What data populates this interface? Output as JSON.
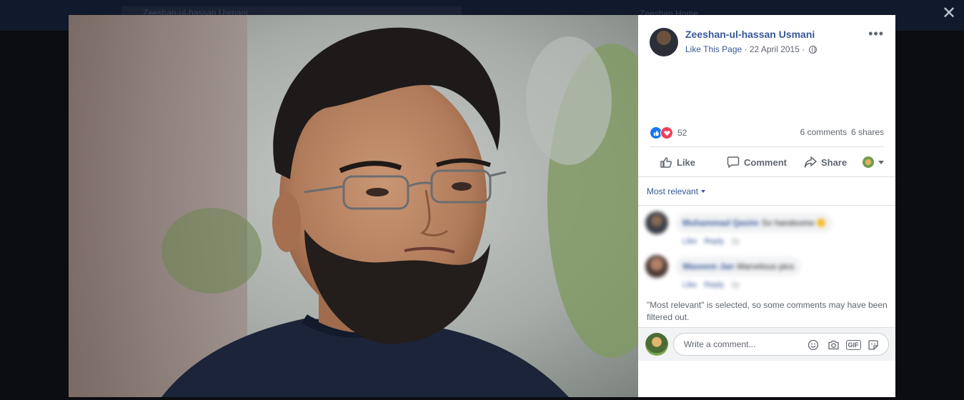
{
  "background": {
    "search_text": "Zeeshan-ul-hassan Usmani",
    "nav_text": "Zeeshan   Home"
  },
  "post": {
    "author": "Zeeshan-ul-hassan Usmani",
    "like_page_label": "Like This Page",
    "separator": " · ",
    "date": "22 April 2015",
    "privacy_icon": "globe-icon"
  },
  "engagement": {
    "reaction_icons": [
      "like-reaction-icon",
      "love-reaction-icon"
    ],
    "reaction_count": "52",
    "comments": "6 comments",
    "shares": "6 shares"
  },
  "actions": {
    "like": "Like",
    "comment": "Comment",
    "share": "Share"
  },
  "comments_section": {
    "filter_label": "Most relevant",
    "items": [
      {
        "name": "Muhammad Qasim",
        "text": "So handsome",
        "links": [
          "Like",
          "Reply"
        ],
        "time": "2y"
      },
      {
        "name": "Waseem Jan",
        "text": "Marvelous pics",
        "links": [
          "Like",
          "Reply"
        ],
        "time": "2y"
      }
    ],
    "notice": "\"Most relevant\" is selected, so some comments may have been filtered out."
  },
  "composer": {
    "placeholder": "Write a comment...",
    "icons": [
      "emoji-icon",
      "camera-icon",
      "gif-icon",
      "sticker-icon"
    ],
    "gif_label": "GIF"
  },
  "colors": {
    "link": "#385898",
    "meta": "#616770",
    "like_blue": "#1877f2",
    "love_red": "#f33e58",
    "overlay_bg": "#0b0d11"
  }
}
